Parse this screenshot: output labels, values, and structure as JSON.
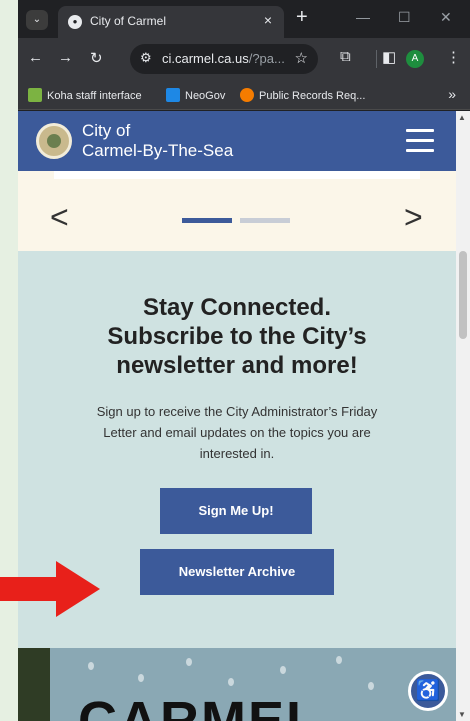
{
  "browser": {
    "tab_title": "City of Carmel",
    "tab_close": "×",
    "new_tab": "+",
    "window_minimize": "—",
    "window_maximize": "☐",
    "window_close": "✕",
    "url_domain": "ci.carmel.ca.us",
    "url_rest": "/?pa...",
    "profile_initial": "A"
  },
  "bookmarks": [
    {
      "label": "Koha staff interface",
      "color": "#7cb342"
    },
    {
      "label": "NeoGov",
      "color": "#1e88e5"
    },
    {
      "label": "Public Records Req...",
      "color": "#f57c00"
    }
  ],
  "site": {
    "title_line1": "City of",
    "title_line2": "Carmel-By-The-Sea",
    "brand_color": "#3c5a9a"
  },
  "carousel": {
    "prev": "<",
    "next": ">",
    "active_dot_color": "#3c5a9a",
    "inactive_dot_color": "#c8cdd6"
  },
  "subscribe": {
    "heading_line1": "Stay Connected.",
    "heading_line2": "Subscribe to the City’s",
    "heading_line3": "newsletter and more!",
    "body_line1": "Sign up to receive the City Administrator’s Friday",
    "body_line2": "Letter and email updates on the topics you are",
    "body_line3": "interested in.",
    "signup_label": "Sign Me Up!",
    "archive_label": "Newsletter Archive"
  },
  "photo": {
    "text": "CARMEL"
  },
  "annotation": {
    "arrow_color": "#e8201a"
  }
}
